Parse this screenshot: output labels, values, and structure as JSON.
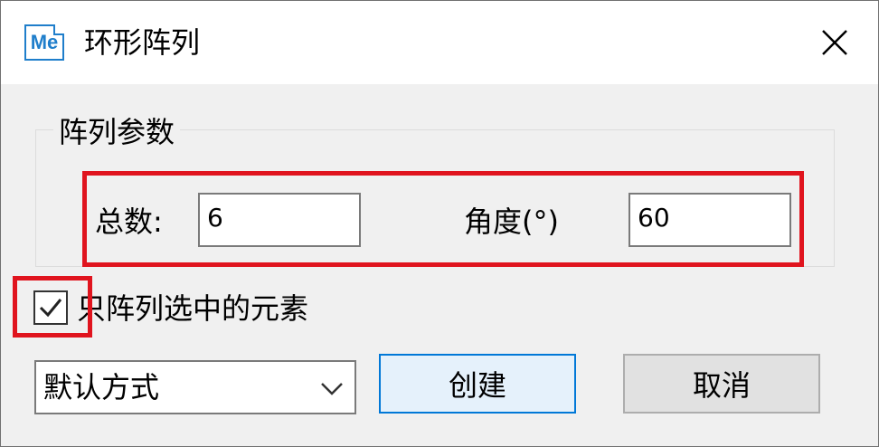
{
  "window": {
    "title": "环形阵列",
    "app_icon_text": "Me"
  },
  "group": {
    "title": "阵列参数",
    "count_label": "总数:",
    "count_value": "6",
    "angle_label": "角度(°)",
    "angle_value": "60"
  },
  "option": {
    "checked": true,
    "label": "只阵列选中的元素"
  },
  "mode_select": {
    "value": "默认方式"
  },
  "buttons": {
    "create": "创建",
    "cancel": "取消"
  },
  "colors": {
    "highlight": "#e0141e",
    "accent": "#0078d7",
    "icon": "#1f7ecb"
  }
}
